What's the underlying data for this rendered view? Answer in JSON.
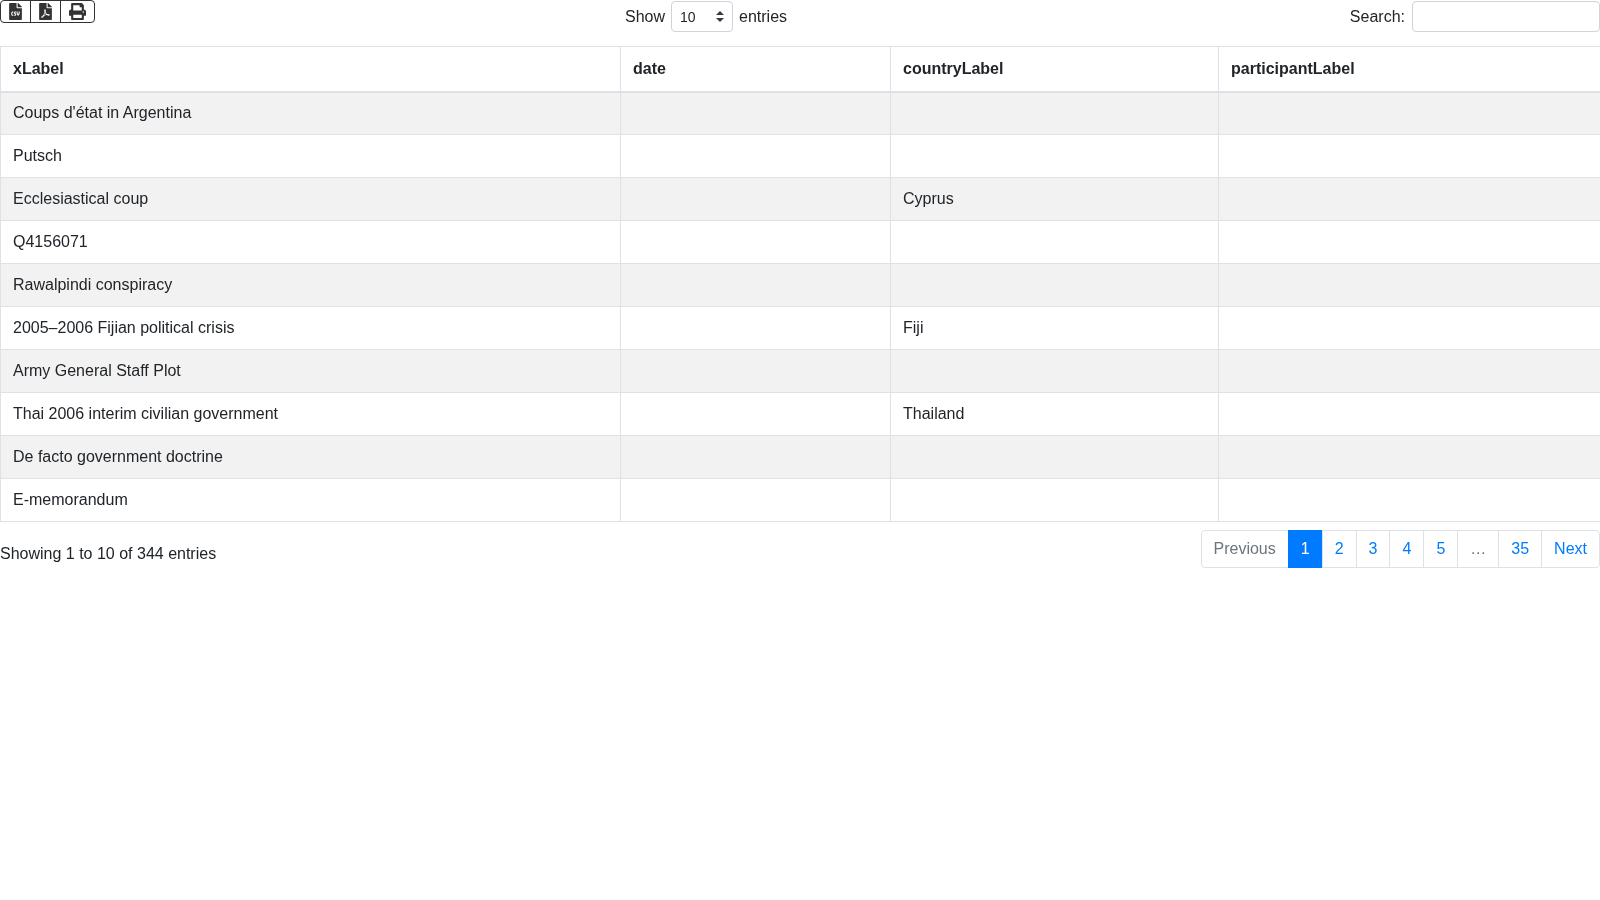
{
  "length_menu": {
    "label_before": "Show",
    "value": "10",
    "label_after": "entries"
  },
  "search": {
    "label": "Search:"
  },
  "table": {
    "columns": [
      "xLabel",
      "date",
      "countryLabel",
      "participantLabel"
    ],
    "rows": [
      [
        "Coups d'état in Argentina",
        "",
        "",
        ""
      ],
      [
        "Putsch",
        "",
        "",
        ""
      ],
      [
        "Ecclesiastical coup",
        "",
        "Cyprus",
        ""
      ],
      [
        "Q4156071",
        "",
        "",
        ""
      ],
      [
        "Rawalpindi conspiracy",
        "",
        "",
        ""
      ],
      [
        "2005–2006 Fijian political crisis",
        "",
        "Fiji",
        ""
      ],
      [
        "Army General Staff Plot",
        "",
        "",
        ""
      ],
      [
        "Thai 2006 interim civilian government",
        "",
        "Thailand",
        ""
      ],
      [
        "De facto government doctrine",
        "",
        "",
        ""
      ],
      [
        "E-memorandum",
        "",
        "",
        ""
      ]
    ]
  },
  "info": "Showing 1 to 10 of 344 entries",
  "pagination": [
    {
      "label": "Previous",
      "selected": false,
      "disabled": true
    },
    {
      "label": "1",
      "selected": true,
      "disabled": false
    },
    {
      "label": "2",
      "selected": false,
      "disabled": false
    },
    {
      "label": "3",
      "selected": false,
      "disabled": false
    },
    {
      "label": "4",
      "selected": false,
      "disabled": false
    },
    {
      "label": "5",
      "selected": false,
      "disabled": false
    },
    {
      "label": "…",
      "selected": false,
      "disabled": true
    },
    {
      "label": "35",
      "selected": false,
      "disabled": false
    },
    {
      "label": "Next",
      "selected": false,
      "disabled": false
    }
  ]
}
